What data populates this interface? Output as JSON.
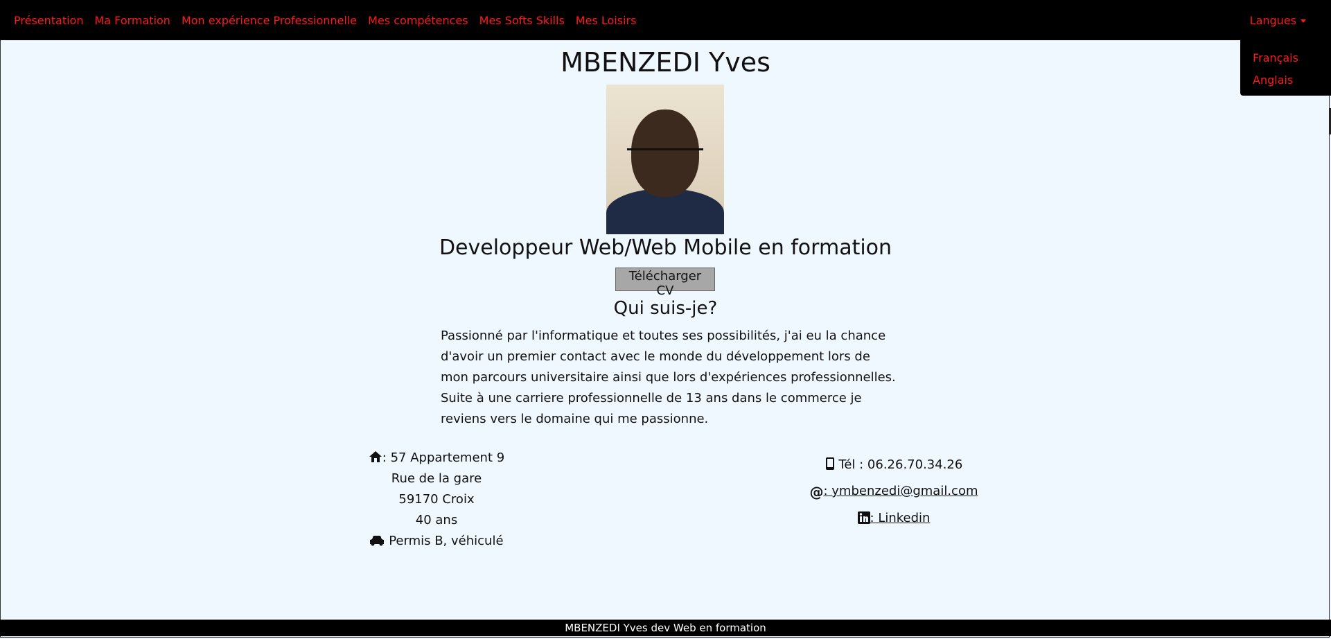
{
  "nav": {
    "links": [
      "Présentation",
      "Ma Formation",
      "Mon expérience Professionnelle",
      "Mes compétences",
      "Mes Softs Skills",
      "Mes Loisirs"
    ],
    "language_toggle": "Langues",
    "language_options": [
      "Français",
      "Anglais"
    ]
  },
  "header": {
    "name": "MBENZEDI Yves",
    "role": "Developpeur Web/Web Mobile en formation",
    "cv_button": "Télécharger CV"
  },
  "about": {
    "heading": "Qui suis-je?",
    "text": "Passionné par l'informatique et toutes ses possibilités, j'ai eu la chance d'avoir un premier contact avec le monde du développement lors de mon parcours universitaire ainsi que lors d'expériences professionnelles. Suite à une carriere professionnelle de 13 ans dans le commerce je reviens vers le domaine qui me passionne."
  },
  "contact": {
    "address_line1": ": 57 Appartement 9",
    "address_line2": "Rue de la gare",
    "address_line3": "59170 Croix",
    "age": "40 ans",
    "license": "Permis B, véhiculé",
    "phone": "Tél : 06.26.70.34.26",
    "email_prefix": ":",
    "email": " ymbenzedi@gmail.com",
    "linkedin_prefix": ":",
    "linkedin": " Linkedin"
  },
  "footer": {
    "text": "MBENZEDI Yves dev Web en formation"
  }
}
